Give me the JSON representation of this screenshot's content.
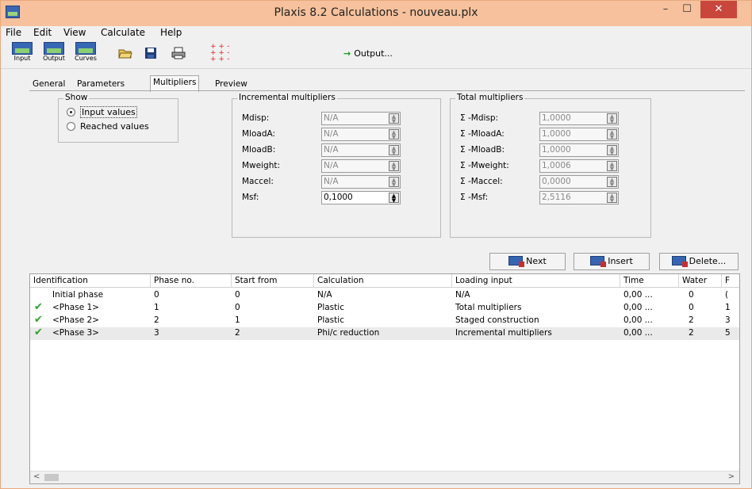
{
  "window": {
    "title": "Plaxis 8.2 Calculations - nouveau.plx",
    "min_glyph": "–",
    "max_glyph": "☐",
    "close_glyph": "✕"
  },
  "menu": [
    "File",
    "Edit",
    "View",
    "Calculate",
    "Help"
  ],
  "toolbar": {
    "input_label": "Input",
    "output_label": "Output",
    "curves_label": "Curves",
    "output_button": "Output..."
  },
  "tabs": [
    "General",
    "Parameters",
    "Multipliers",
    "Preview"
  ],
  "active_tab": "Multipliers",
  "show": {
    "title": "Show",
    "options": [
      "Input values",
      "Reached values"
    ],
    "selected": "Input values"
  },
  "incremental": {
    "title": "Incremental multipliers",
    "rows": [
      {
        "label": "Mdisp:",
        "value": "N/A"
      },
      {
        "label": "MloadA:",
        "value": "N/A"
      },
      {
        "label": "MloadB:",
        "value": "N/A"
      },
      {
        "label": "Mweight:",
        "value": "N/A"
      },
      {
        "label": "Maccel:",
        "value": "N/A"
      },
      {
        "label": "Msf:",
        "value": "0,1000"
      }
    ]
  },
  "total": {
    "title": "Total multipliers",
    "rows": [
      {
        "label": "Σ -Mdisp:",
        "value": "1,0000"
      },
      {
        "label": "Σ -MloadA:",
        "value": "1,0000"
      },
      {
        "label": "Σ -MloadB:",
        "value": "1,0000"
      },
      {
        "label": "Σ -Mweight:",
        "value": "1,0006"
      },
      {
        "label": "Σ -Maccel:",
        "value": "0,0000"
      },
      {
        "label": "Σ -Msf:",
        "value": "2,5116"
      }
    ]
  },
  "actions": {
    "next": "Next",
    "insert": "Insert",
    "delete": "Delete..."
  },
  "table": {
    "columns": [
      "Identification",
      "Phase no.",
      "Start from",
      "Calculation",
      "Loading input",
      "Time",
      "Water",
      "F"
    ],
    "rows": [
      {
        "check": "",
        "id": "Initial phase",
        "phase": "0",
        "start": "0",
        "calc": "N/A",
        "loading": "N/A",
        "time": "0,00 ...",
        "water": "0",
        "f": "("
      },
      {
        "check": "✔",
        "id": "<Phase 1>",
        "phase": "1",
        "start": "0",
        "calc": "Plastic",
        "loading": "Total multipliers",
        "time": "0,00 ...",
        "water": "0",
        "f": "1"
      },
      {
        "check": "✔",
        "id": "<Phase 2>",
        "phase": "2",
        "start": "1",
        "calc": "Plastic",
        "loading": "Staged construction",
        "time": "0,00 ...",
        "water": "2",
        "f": "3"
      },
      {
        "check": "✔",
        "id": "<Phase 3>",
        "phase": "3",
        "start": "2",
        "calc": "Phi/c reduction",
        "loading": "Incremental multipliers",
        "time": "0,00 ...",
        "water": "2",
        "f": "5"
      }
    ],
    "scroll_left": "<",
    "scroll_right": ">"
  }
}
